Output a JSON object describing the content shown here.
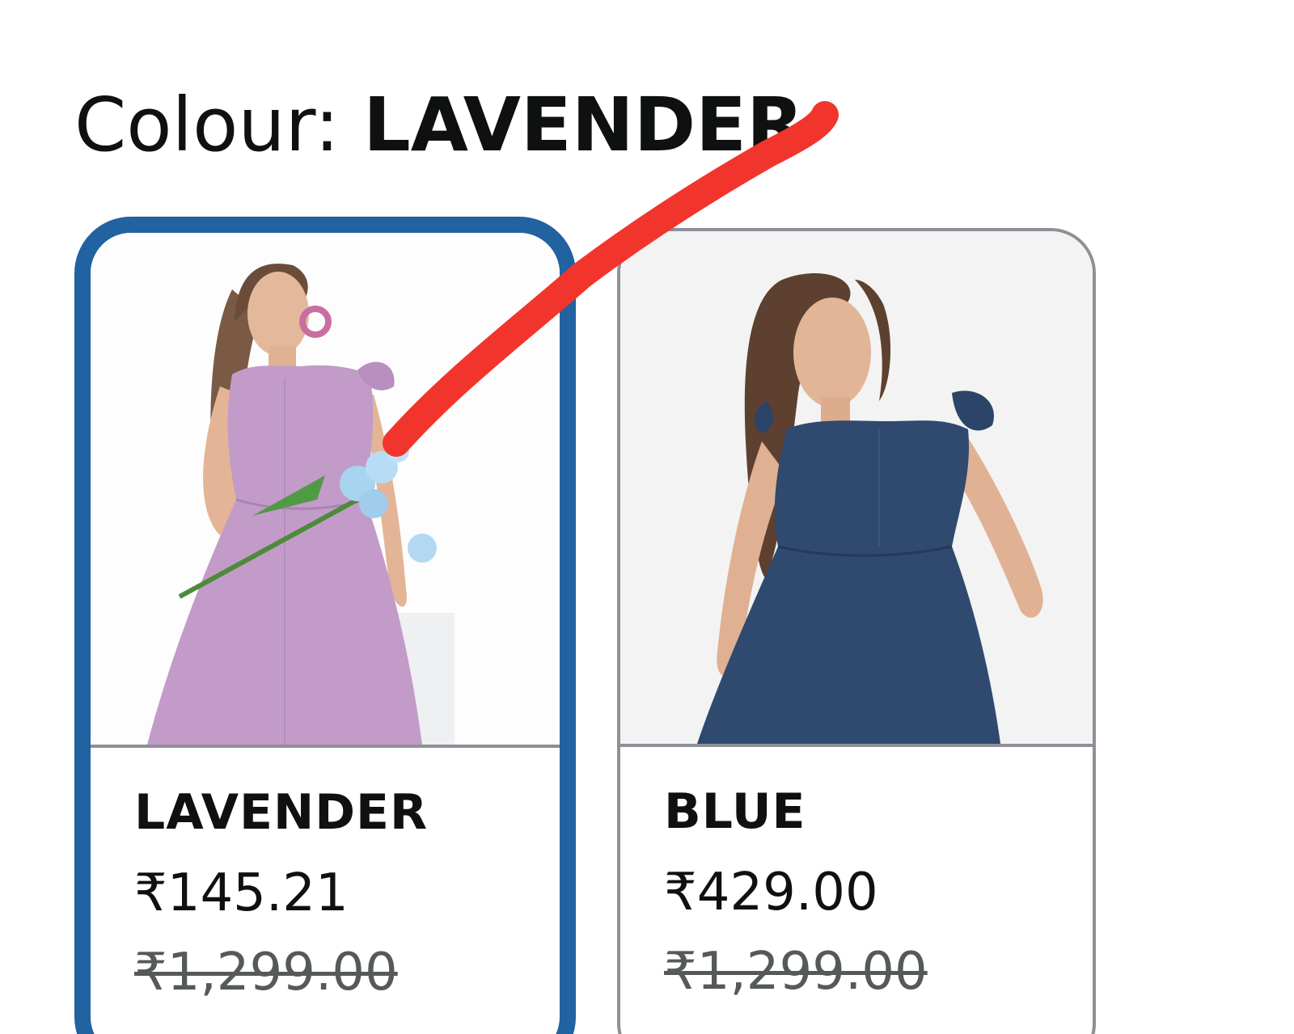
{
  "colour_selector": {
    "label": "Colour: ",
    "selected_value": "LAVENDER"
  },
  "swatches": [
    {
      "name": "LAVENDER",
      "price": "₹145.21",
      "mrp": "₹1,299.00",
      "selected": true,
      "dress_color": "#c39bc9"
    },
    {
      "name": "BLUE",
      "price": "₹429.00",
      "mrp": "₹1,299.00",
      "selected": false,
      "dress_color": "#2f4a6e"
    }
  ],
  "colors": {
    "selected_border": "#2162a1",
    "unselected_border": "#8d9096",
    "annotation_stroke": "#f2352c",
    "strike_price": "#565959"
  }
}
